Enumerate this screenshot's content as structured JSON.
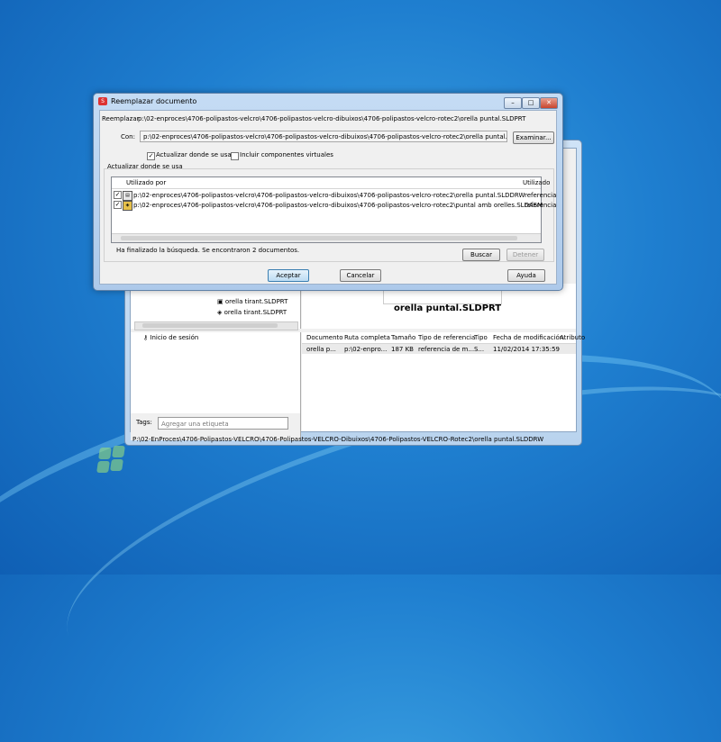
{
  "dialog": {
    "title": "Reemplazar documento",
    "replace_label": "Reemplazar",
    "replace_value": "p:\\02-enproces\\4706-polipastos-velcro\\4706-polipastos-velcro-dibuixos\\4706-polipastos-velcro-rotec2\\orella puntal.SLDPRT",
    "with_label": "Con:",
    "with_value": "p:\\02-enproces\\4706-polipastos-velcro\\4706-polipastos-velcro-dibuixos\\4706-polipastos-velcro-rotec2\\orella puntal.SLDPRT",
    "browse_label": "Examinar...",
    "update_where_used_label": "Actualizar donde se usa",
    "include_virtual_label": "Incluir componentes virtuales",
    "group_label": "Actualizar donde se usa",
    "list": {
      "col_used_by": "Utilizado por",
      "col_used": "Utilizado",
      "rows": [
        {
          "path": "p:\\02-enproces\\4706-polipastos-velcro\\4706-polipastos-velcro-dibuixos\\4706-polipastos-velcro-rotec2\\orella puntal.SLDDRW",
          "ref": "referencia"
        },
        {
          "path": "p:\\02-enproces\\4706-polipastos-velcro\\4706-polipastos-velcro-dibuixos\\4706-polipastos-velcro-rotec2\\puntal amb orelles.SLDASM",
          "ref": "referencia"
        }
      ]
    },
    "status": "Ha finalizado la búsqueda. Se encontraron 2 documentos.",
    "search_label": "Buscar",
    "stop_label": "Detener",
    "ok_label": "Aceptar",
    "cancel_label": "Cancelar",
    "help_label": "Ayuda"
  },
  "explorer": {
    "tree_items": [
      "orella tirant.SLDPRT",
      "orella tirant.SLDPRT"
    ],
    "session_item": "Inicio de sesión",
    "tags_label": "Tags:",
    "tags_placeholder": "Agregar una etiqueta",
    "preview_name": "orella puntal.SLDPRT",
    "columns": [
      "Documento",
      "Ruta completa",
      "Tamaño",
      "Tipo de referencia",
      "Tipo",
      "Fecha de modificación",
      "Atributo"
    ],
    "row": [
      "orella p...",
      "p:\\02-enpro...",
      "187 KB",
      "referencia de m...",
      "S...",
      "11/02/2014 17:35:59",
      ""
    ],
    "status_path": "P:\\02-EnProces\\4706-Polipastos-VELCRO\\4706-Polipastos-VELCRO-Dibuixos\\4706-Polipastos-VELCRO-Rotec2\\orella puntal.SLDDRW"
  }
}
